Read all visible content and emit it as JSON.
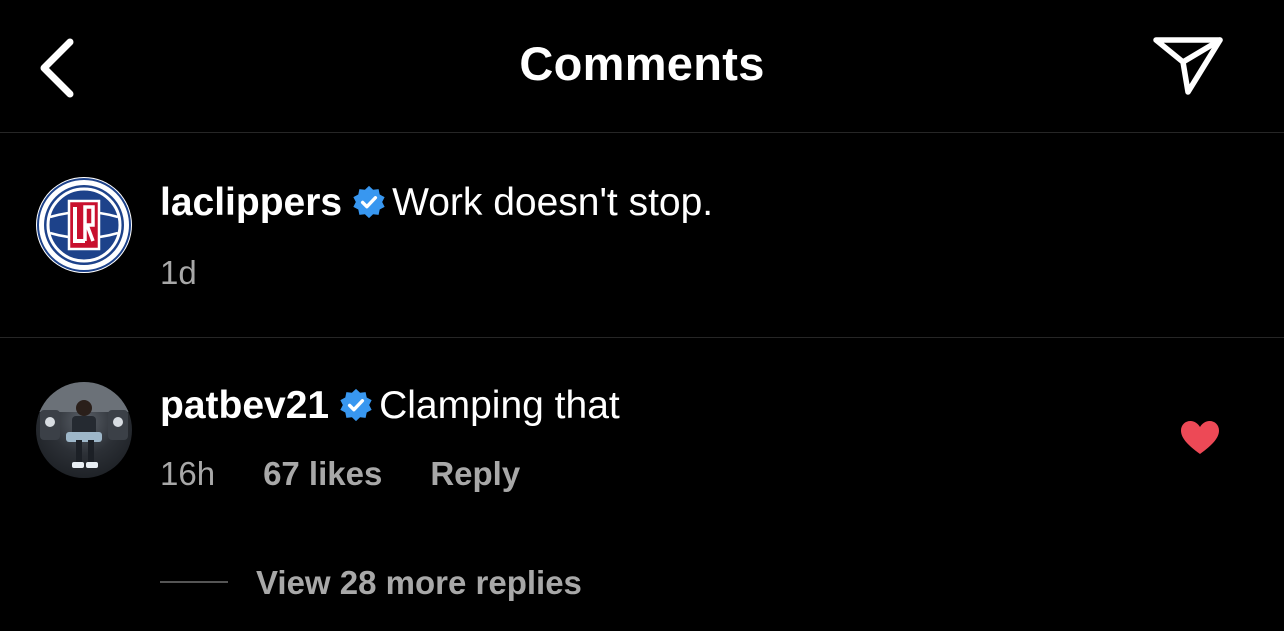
{
  "header": {
    "title": "Comments",
    "back_icon": "chevron-left-icon",
    "share_icon": "paper-plane-icon"
  },
  "caption": {
    "username": "laclippers",
    "verified": true,
    "text": "Work doesn't stop.",
    "time": "1d"
  },
  "comments": [
    {
      "username": "patbev21",
      "verified": true,
      "text": "Clamping that",
      "time": "16h",
      "likes": "67 likes",
      "reply_label": "Reply",
      "liked": true,
      "view_replies": "View 28 more replies"
    }
  ],
  "colors": {
    "background": "#000000",
    "text": "#ffffff",
    "secondary_text": "#a8a8a8",
    "verified_badge": "#3897f0",
    "heart": "#ed4956",
    "divider": "#262626"
  }
}
